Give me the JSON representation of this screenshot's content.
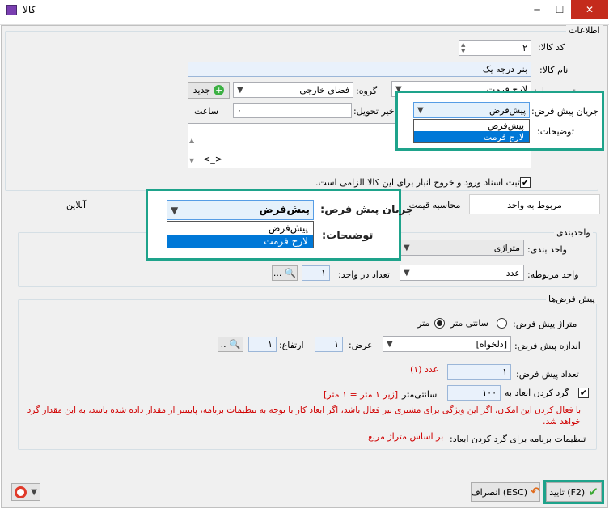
{
  "window": {
    "title": "کالا",
    "minimize": "─",
    "maximize": "☐",
    "close": "✕"
  },
  "info": {
    "group_title": "اطلاعات",
    "code_label": "کد کالا:",
    "code_value": "۲",
    "name_label": "نام کالا:",
    "name_value": "بنر درجه یک",
    "category_label": "رسته مربوطه:",
    "category_value": "لارج فرمت",
    "group_label": "گروه:",
    "group_value": "فضای خارجی",
    "new_button": "جدید",
    "default_flow_label": "جریان پیش فرض:",
    "default_flow_value": "پیش‌فرض",
    "delivery_delay_label": "تاخیر تحویل:",
    "delivery_delay_value": "۰",
    "hour_label": "ساعت",
    "description_label": "توضیحات:",
    "description_value": "<_>",
    "inventory_checkbox_label": "ثبت اسناد ورود و خروج انبار برای این کالا الزامی است."
  },
  "dropdown_small": {
    "options": [
      "پیش‌فرض",
      "لارج فرمت"
    ],
    "selected_index": 1
  },
  "callout": {
    "flow_label": "جریان پیش فرض:",
    "flow_value": "پیش‌فرض",
    "options": [
      "پیش‌فرض",
      "لارج فرمت"
    ],
    "selected_index": 1,
    "description_label": "توضیحات:"
  },
  "tabs": [
    {
      "label": "مربوط به واحد",
      "active": true
    },
    {
      "label": "محاسبه قیمت",
      "active": false
    },
    {
      "label": "آنلاین",
      "active": false
    }
  ],
  "unit": {
    "group_title": "واحدبندی",
    "unitization_label": "واحد بندی:",
    "unitization_value": "متراژی",
    "related_unit_label": "واحد مربوطه:",
    "related_unit_value": "عدد",
    "count_label": "تعداد در واحد:",
    "count_value": "۱",
    "browse_label": "..."
  },
  "defaults": {
    "group_title": "پیش فرض‌ها",
    "area_label": "متراژ پیش فرض:",
    "option_cm": "سانتی متر",
    "option_m": "متر",
    "size_label": "اندازه پیش فرض:",
    "size_value": "[دلخواه]",
    "width_label": "عرض:",
    "width_value": "۱",
    "height_label": "ارتفاع:",
    "height_value": "۱",
    "browse_label": "..",
    "qty_label": "تعداد پیش فرض:",
    "qty_value": "۱",
    "qty_unit": "عدد (۱)",
    "round_label": "گرد کردن ابعاد به",
    "round_value": "۱۰۰",
    "round_unit": "سانتی‌متر",
    "round_note": "[زیر ۱ متر = ۱ متر]",
    "warning": "با فعال کردن این امکان، اگر این ویژگی برای مشتری نیز فعال باشد، اگر ابعاد کار با توجه به تنظیمات برنامه، پایینتر از مقدار داده شده باشد، به این مقدار گرد خواهد شد.",
    "settings_label": "تنظیمات برنامه برای گرد کردن ابعاد:",
    "settings_value": "بر اساس متراژ مربع"
  },
  "footer": {
    "ok_button": "تایید (F2)",
    "cancel_button": "انصراف (ESC)"
  },
  "colors": {
    "accent": "#1ea38b",
    "selection": "#0078d7",
    "warning": "#d00000"
  }
}
